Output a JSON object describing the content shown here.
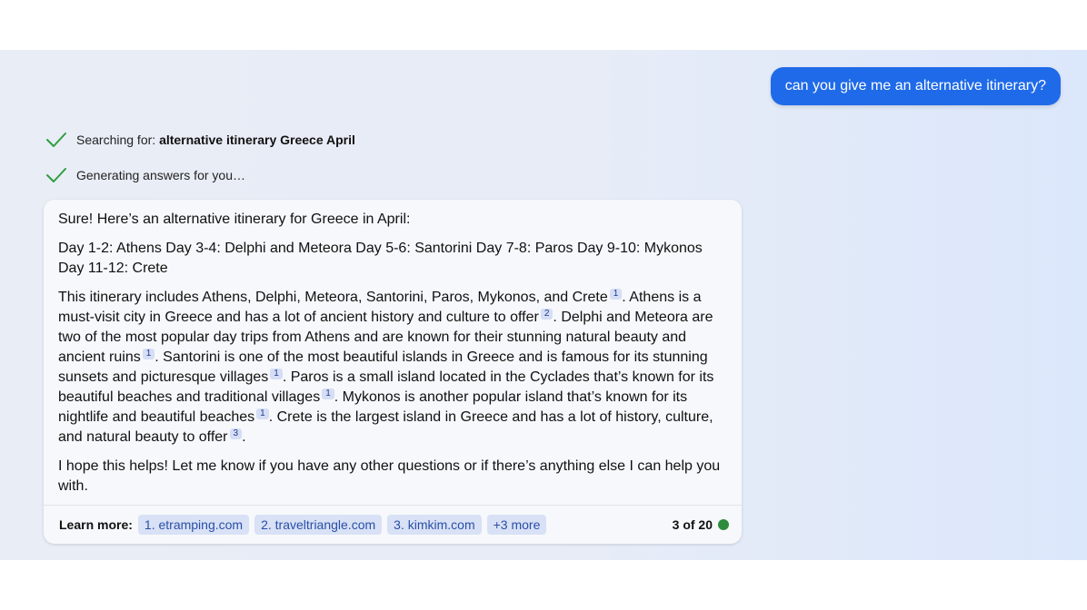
{
  "user_message": "can you give me an alternative itinerary?",
  "status": {
    "searching_prefix": "Searching for: ",
    "searching_query": "alternative itinerary Greece April",
    "generating": "Generating answers for you…"
  },
  "answer": {
    "intro": "Sure! Here’s an alternative itinerary for Greece in April:",
    "itinerary": "Day 1-2: Athens Day 3-4: Delphi and Meteora Day 5-6: Santorini Day 7-8: Paros Day 9-10: Mykonos Day 11-12: Crete",
    "details": [
      {
        "text": "This itinerary includes Athens, Delphi, Meteora, Santorini, Paros, Mykonos, and Crete",
        "cite": "1"
      },
      {
        "text": ". Athens is a must-visit city in Greece and has a lot of ancient history and culture to offer",
        "cite": "2"
      },
      {
        "text": ". Delphi and Meteora are two of the most popular day trips from Athens and are known for their stunning natural beauty and ancient ruins",
        "cite": "1"
      },
      {
        "text": ". Santorini is one of the most beautiful islands in Greece and is famous for its stunning sunsets and picturesque villages",
        "cite": "1"
      },
      {
        "text": ". Paros is a small island located in the Cyclades that’s known for its beautiful beaches and traditional villages",
        "cite": "1"
      },
      {
        "text": ". Mykonos is another popular island that’s known for its nightlife and beautiful beaches",
        "cite": "1"
      },
      {
        "text": ". Crete is the largest island in Greece and has a lot of history, culture, and natural beauty to offer",
        "cite": "3"
      }
    ],
    "details_end": ".",
    "closing": "I hope this helps! Let me know if you have any other questions or if there’s anything else I can help you with."
  },
  "footer": {
    "learn_more_label": "Learn more:",
    "sources": [
      "1. etramping.com",
      "2. traveltriangle.com",
      "3. kimkim.com"
    ],
    "more_label": "+3 more",
    "counter": "3 of 20",
    "status_dot_color": "#2e8b3e"
  },
  "colors": {
    "accent": "#1f6ae9",
    "check": "#2e9e3e"
  },
  "icons": {
    "search_status": "checkmark-icon",
    "generate_status": "checkmark-icon"
  }
}
